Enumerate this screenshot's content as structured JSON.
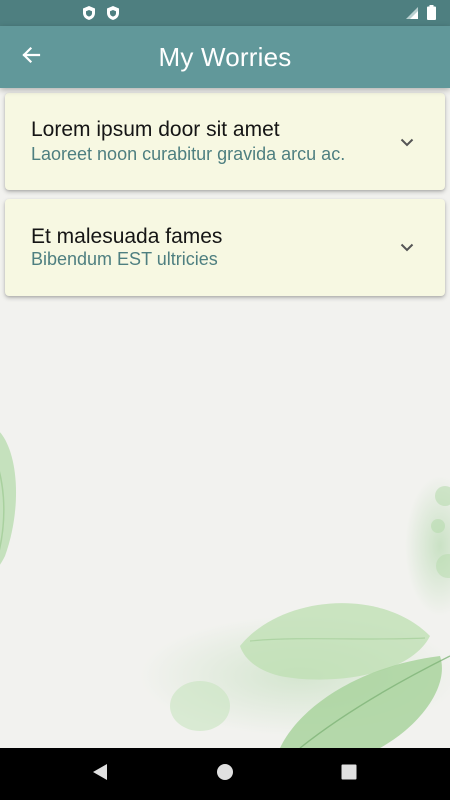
{
  "status_bar": {
    "left_icons": [
      "shield-icon",
      "shield-icon"
    ],
    "right_icons": [
      "cell-signal-icon",
      "battery-icon"
    ]
  },
  "app_bar": {
    "title": "My Worries",
    "back_icon": "arrow-left-icon"
  },
  "worries": [
    {
      "title": "Lorem ipsum door sit amet",
      "subtitle": "Laoreet noon curabitur gravida arcu ac.",
      "icon": "chevron-down-icon"
    },
    {
      "title": "Et malesuada fames",
      "subtitle": "Bibendum EST ultricies",
      "icon": "chevron-down-icon"
    }
  ],
  "nav_bar": {
    "icons": [
      "triangle-back-icon",
      "circle-home-icon",
      "square-recents-icon"
    ]
  },
  "colors": {
    "status_bar": "#4e7f80",
    "app_bar": "#61989a",
    "card_background": "#f7f8e2",
    "subtitle_text": "#4e7f80",
    "title_text": "#151515",
    "page_background": "#f2f2ef"
  }
}
